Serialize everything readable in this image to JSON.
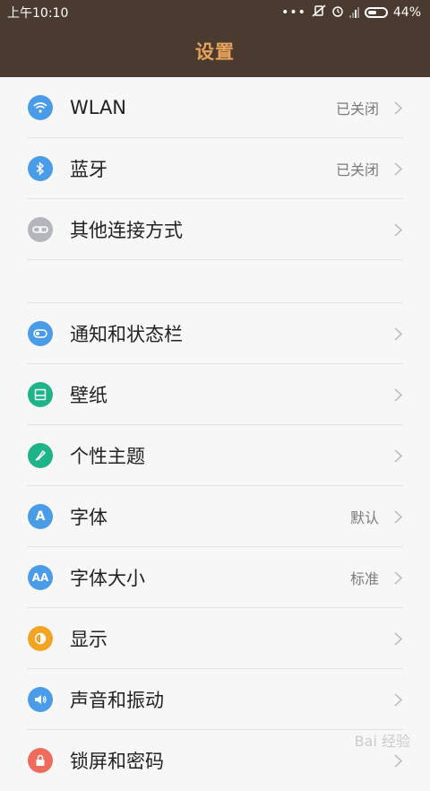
{
  "status_bar": {
    "time": "上午10:10",
    "battery": "44%"
  },
  "header": {
    "title": "设置"
  },
  "groups": [
    {
      "items": [
        {
          "label": "WLAN",
          "value": "已关闭",
          "icon": "wifi-icon",
          "color": "#4a9ce8"
        },
        {
          "label": "蓝牙",
          "value": "已关闭",
          "icon": "bluetooth-icon",
          "color": "#4a9ce8"
        },
        {
          "label": "其他连接方式",
          "value": "",
          "icon": "link-icon",
          "color": "#b3b7bd"
        }
      ]
    },
    {
      "items": [
        {
          "label": "通知和状态栏",
          "value": "",
          "icon": "toggle-icon",
          "color": "#4a9ce8"
        },
        {
          "label": "壁纸",
          "value": "",
          "icon": "wallpaper-icon",
          "color": "#1db48a"
        },
        {
          "label": "个性主题",
          "value": "",
          "icon": "brush-icon",
          "color": "#1db48a"
        },
        {
          "label": "字体",
          "value": "默认",
          "icon": "font-icon",
          "color": "#4a9ce8"
        },
        {
          "label": "字体大小",
          "value": "标准",
          "icon": "font-size-icon",
          "color": "#4a9ce8"
        },
        {
          "label": "显示",
          "value": "",
          "icon": "display-icon",
          "color": "#f2a523"
        },
        {
          "label": "声音和振动",
          "value": "",
          "icon": "speaker-icon",
          "color": "#4a9ce8"
        },
        {
          "label": "锁屏和密码",
          "value": "",
          "icon": "lock-icon",
          "color": "#ef6b5b"
        }
      ]
    }
  ],
  "watermark": "Bai 经验"
}
